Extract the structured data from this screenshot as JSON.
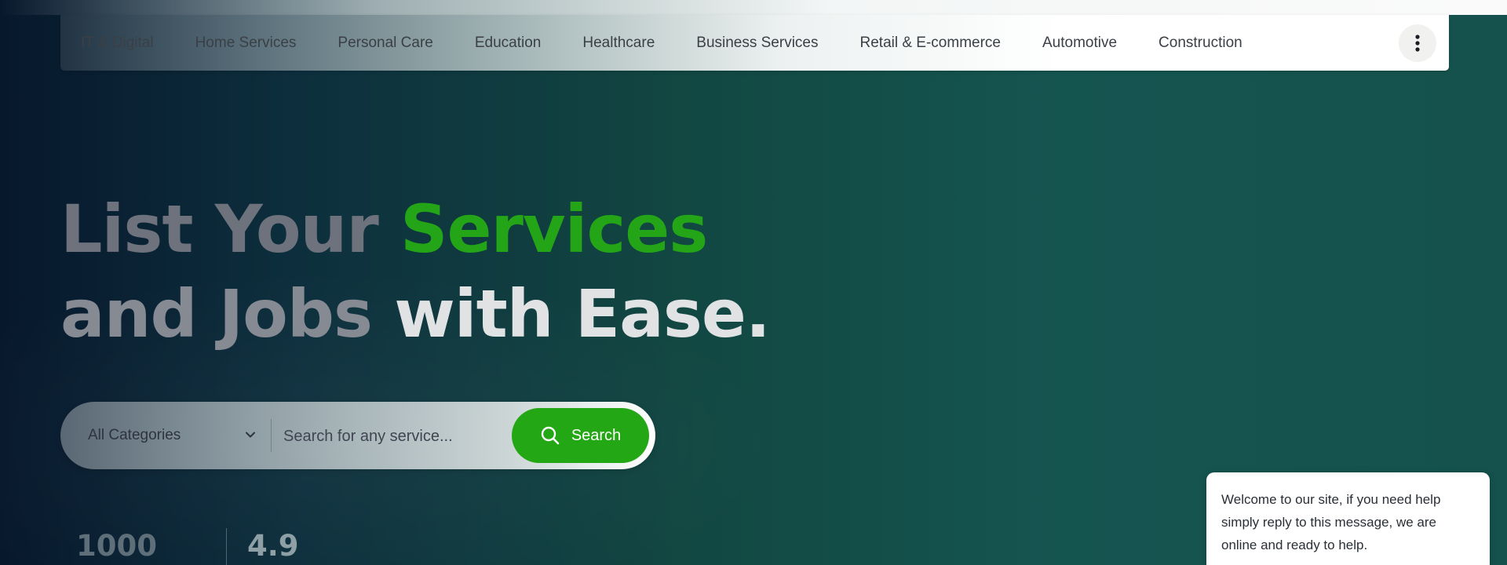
{
  "nav": {
    "categories": [
      "IT & Digital",
      "Home Services",
      "Personal Care",
      "Education",
      "Healthcare",
      "Business Services",
      "Retail & E-commerce",
      "Automotive",
      "Construction"
    ],
    "more_icon": "more-vertical-icon"
  },
  "hero": {
    "line1_prefix": "List Your ",
    "line1_accent": "Services",
    "line2_part1": "and Jobs ",
    "line2_part2": "with Ease."
  },
  "search": {
    "category_value": "All Categories",
    "placeholder": "Search for any service...",
    "button_label": "Search",
    "button_icon": "search-icon",
    "dropdown_icon": "chevron-down-icon"
  },
  "stats": [
    {
      "value": "1000"
    },
    {
      "value": "4.9"
    }
  ],
  "chat": {
    "message": "Welcome to our site, if you need help simply reply to this message, we are online and ready to help."
  },
  "colors": {
    "accent": "#24a417",
    "button": "#23a714",
    "background": "#15524d"
  }
}
